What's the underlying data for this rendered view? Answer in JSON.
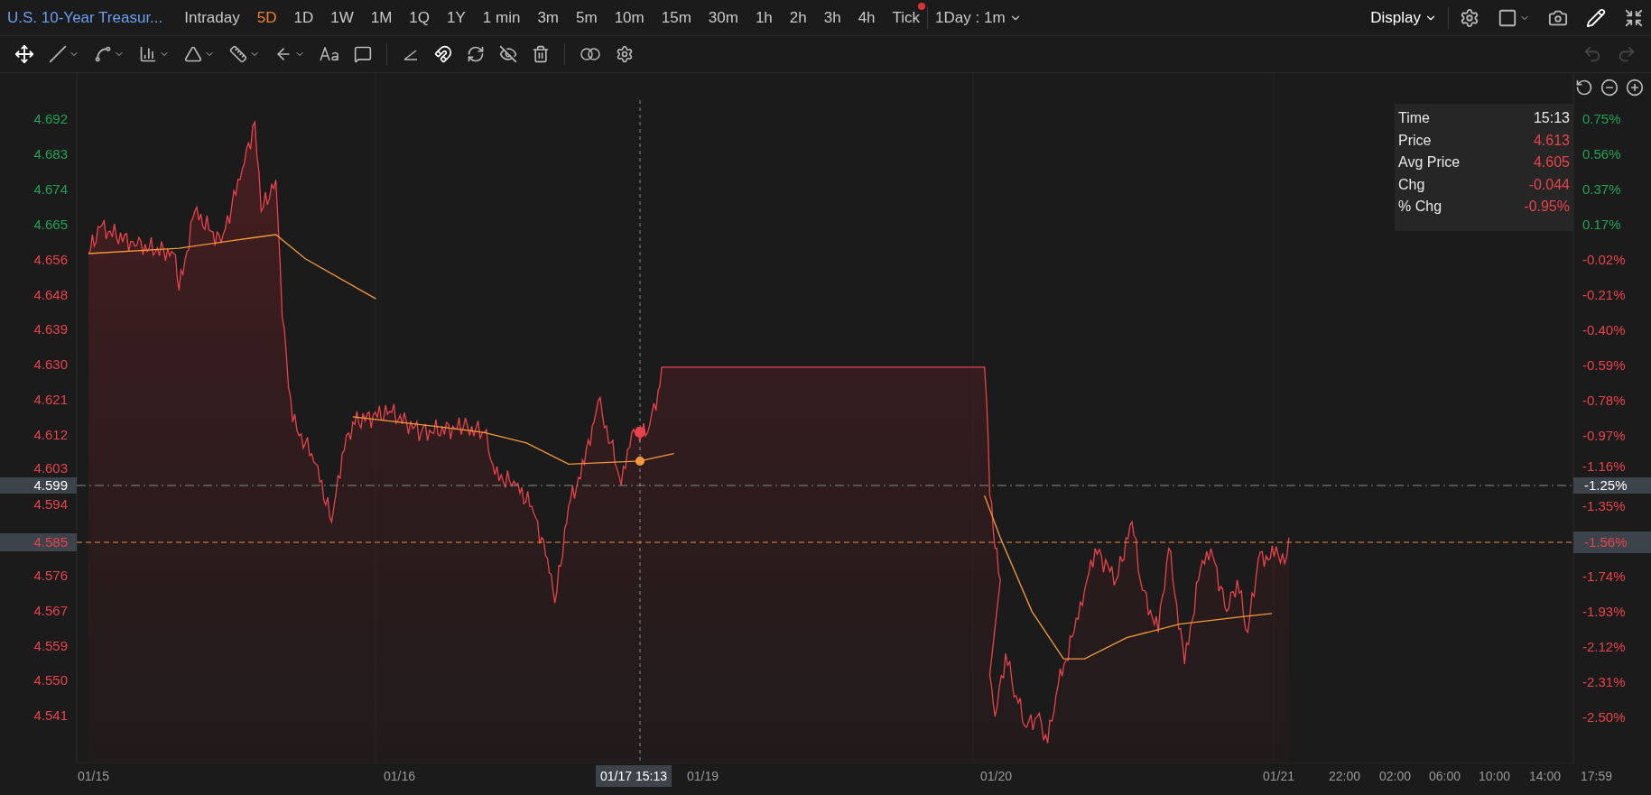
{
  "header": {
    "title": "U.S. 10-Year Treasur...",
    "periods": [
      {
        "label": "Intraday",
        "selected": false,
        "dot": false
      },
      {
        "label": "5D",
        "selected": true,
        "dot": false
      },
      {
        "label": "1D",
        "selected": false,
        "dot": false
      },
      {
        "label": "1W",
        "selected": false,
        "dot": false
      },
      {
        "label": "1M",
        "selected": false,
        "dot": false
      },
      {
        "label": "1Q",
        "selected": false,
        "dot": false
      },
      {
        "label": "1Y",
        "selected": false,
        "dot": false
      },
      {
        "label": "1 min",
        "selected": false,
        "dot": false
      },
      {
        "label": "3m",
        "selected": false,
        "dot": false
      },
      {
        "label": "5m",
        "selected": false,
        "dot": false
      },
      {
        "label": "10m",
        "selected": false,
        "dot": false
      },
      {
        "label": "15m",
        "selected": false,
        "dot": false
      },
      {
        "label": "30m",
        "selected": false,
        "dot": false
      },
      {
        "label": "1h",
        "selected": false,
        "dot": false
      },
      {
        "label": "2h",
        "selected": false,
        "dot": false
      },
      {
        "label": "3h",
        "selected": false,
        "dot": false
      },
      {
        "label": "4h",
        "selected": false,
        "dot": false
      },
      {
        "label": "Tick",
        "selected": false,
        "dot": true
      }
    ],
    "interval": "1Day : 1m",
    "display": "Display"
  },
  "toolbar": {
    "undo_disabled": true,
    "redo_disabled": true
  },
  "info": [
    {
      "label": "Time",
      "value": "15:13",
      "color": "#e6e6e6"
    },
    {
      "label": "Price",
      "value": "4.613",
      "color": "#e8434b"
    },
    {
      "label": "Avg Price",
      "value": "4.605",
      "color": "#e8434b"
    },
    {
      "label": "Chg",
      "value": "-0.044",
      "color": "#e8434b"
    },
    {
      "label": "% Chg",
      "value": "-0.95%",
      "color": "#e8434b"
    }
  ],
  "price_axis": [
    {
      "label": "4.692",
      "color": "#1fa355"
    },
    {
      "label": "4.683",
      "color": "#1fa355"
    },
    {
      "label": "4.674",
      "color": "#1fa355"
    },
    {
      "label": "4.665",
      "color": "#1fa355"
    },
    {
      "label": "4.656",
      "color": "#e8434b"
    },
    {
      "label": "4.648",
      "color": "#e8434b"
    },
    {
      "label": "4.639",
      "color": "#e8434b"
    },
    {
      "label": "4.630",
      "color": "#e8434b"
    },
    {
      "label": "4.621",
      "color": "#e8434b"
    },
    {
      "label": "4.612",
      "color": "#e8434b"
    },
    {
      "label": "4.603",
      "color": "#e8434b"
    },
    {
      "label": "4.594",
      "color": "#e8434b"
    },
    {
      "label": "4.576",
      "color": "#e8434b"
    },
    {
      "label": "4.567",
      "color": "#e8434b"
    },
    {
      "label": "4.559",
      "color": "#e8434b"
    },
    {
      "label": "4.550",
      "color": "#e8434b"
    },
    {
      "label": "4.541",
      "color": "#e8434b"
    }
  ],
  "percent_axis": [
    {
      "label": "0.75%",
      "color": "#1fa355"
    },
    {
      "label": "0.56%",
      "color": "#1fa355"
    },
    {
      "label": "0.37%",
      "color": "#1fa355"
    },
    {
      "label": "0.17%",
      "color": "#1fa355"
    },
    {
      "label": "-0.02%",
      "color": "#e8434b"
    },
    {
      "label": "-0.21%",
      "color": "#e8434b"
    },
    {
      "label": "-0.40%",
      "color": "#e8434b"
    },
    {
      "label": "-0.59%",
      "color": "#e8434b"
    },
    {
      "label": "-0.78%",
      "color": "#e8434b"
    },
    {
      "label": "-0.97%",
      "color": "#e8434b"
    },
    {
      "label": "-1.16%",
      "color": "#e8434b"
    },
    {
      "label": "-1.35%",
      "color": "#e8434b"
    },
    {
      "label": "-1.74%",
      "color": "#e8434b"
    },
    {
      "label": "-1.93%",
      "color": "#e8434b"
    },
    {
      "label": "-2.12%",
      "color": "#e8434b"
    },
    {
      "label": "-2.31%",
      "color": "#e8434b"
    },
    {
      "label": "-2.50%",
      "color": "#e8434b"
    }
  ],
  "crosshair": {
    "price": "4.599",
    "percent": "-1.25%",
    "time": "01/17 15:13"
  },
  "last_price": {
    "price": "4.585",
    "percent": "-1.56%"
  },
  "time_axis": [
    "01/15",
    "01/16",
    "01/19",
    "01/20",
    "01/21",
    "22:00",
    "02:00",
    "06:00",
    "10:00",
    "14:00",
    "17:59"
  ]
}
